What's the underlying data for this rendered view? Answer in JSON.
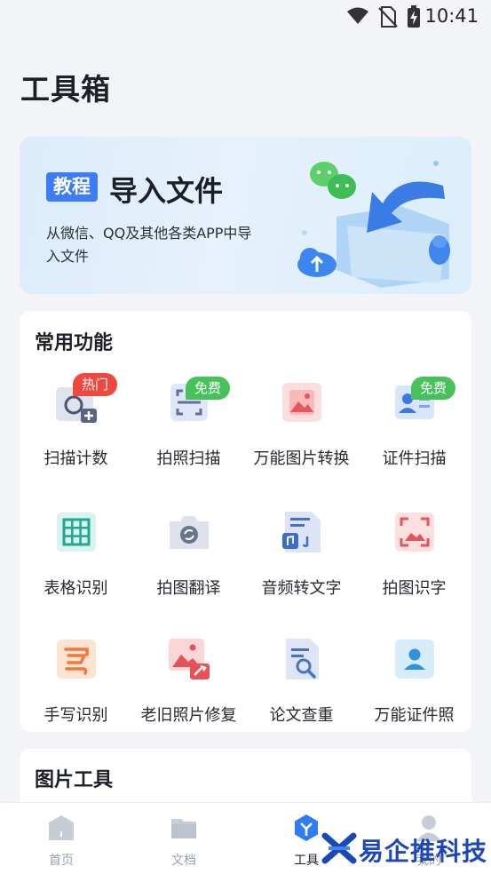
{
  "status_bar": {
    "time": "10:41",
    "icons": [
      "wifi-icon",
      "no-sim-icon",
      "battery-charging-icon"
    ]
  },
  "page": {
    "title": "工具箱"
  },
  "banner": {
    "tag": "教程",
    "title": "导入文件",
    "description": "从微信、QQ及其他各类APP中导入文件",
    "art_icons": [
      "wechat-icon",
      "cloud-upload-icon",
      "folder-icon",
      "qq-penguin-icon",
      "arrow-icon"
    ]
  },
  "common_features": {
    "title": "常用功能",
    "items": [
      {
        "label": "扫描计数",
        "icon": "scan-count-icon",
        "badge": "热门"
      },
      {
        "label": "拍照扫描",
        "icon": "photo-scan-icon",
        "badge": "免费"
      },
      {
        "label": "万能图片转换",
        "icon": "image-convert-icon"
      },
      {
        "label": "证件扫描",
        "icon": "id-scan-icon",
        "badge": "免费"
      },
      {
        "label": "表格识别",
        "icon": "table-recognize-icon"
      },
      {
        "label": "拍图翻译",
        "icon": "photo-translate-icon"
      },
      {
        "label": "音频转文字",
        "icon": "audio-to-text-icon"
      },
      {
        "label": "拍图识字",
        "icon": "photo-ocr-icon"
      },
      {
        "label": "手写识别",
        "icon": "handwriting-icon"
      },
      {
        "label": "老旧照片修复",
        "icon": "photo-repair-icon"
      },
      {
        "label": "论文查重",
        "icon": "paper-check-icon"
      },
      {
        "label": "万能证件照",
        "icon": "id-photo-icon"
      }
    ]
  },
  "image_tools": {
    "title": "图片工具"
  },
  "bottom_nav": {
    "items": [
      {
        "label": "首页",
        "icon": "home-icon"
      },
      {
        "label": "文档",
        "icon": "folder-icon"
      },
      {
        "label": "工具",
        "icon": "tools-icon",
        "active": true
      },
      {
        "label": "我的",
        "icon": "profile-icon"
      }
    ]
  },
  "watermark": {
    "text": "易企推科技"
  },
  "colors": {
    "accent": "#3d7bf7",
    "hot": "#f0483e",
    "free": "#47c25a",
    "background": "#f3f4f7"
  }
}
